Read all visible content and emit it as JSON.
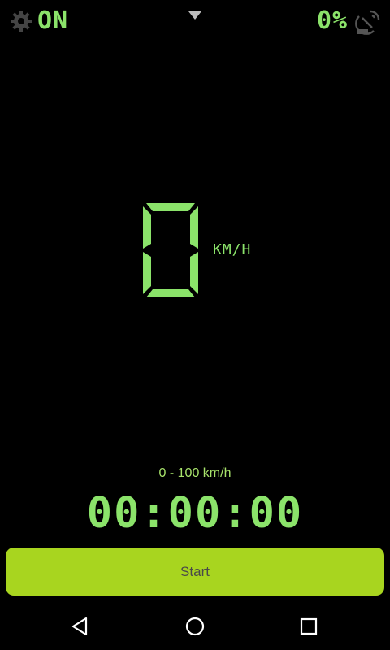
{
  "status": {
    "gps_state": "ON",
    "signal_percent": "0%"
  },
  "speed": {
    "value": "0",
    "unit": "KM/H"
  },
  "acceleration": {
    "range_label": "0 - 100 km/h",
    "timer": "00:00:00"
  },
  "actions": {
    "start_label": "Start"
  },
  "colors": {
    "digital_green": "#8be36a",
    "button_green": "#a8d51f",
    "background": "#000000"
  },
  "icons": {
    "settings": "gear-icon",
    "dropdown": "chevron-down-icon",
    "gps": "satellite-dish-icon",
    "back": "nav-back-icon",
    "home": "nav-home-icon",
    "recent": "nav-recent-icon"
  }
}
